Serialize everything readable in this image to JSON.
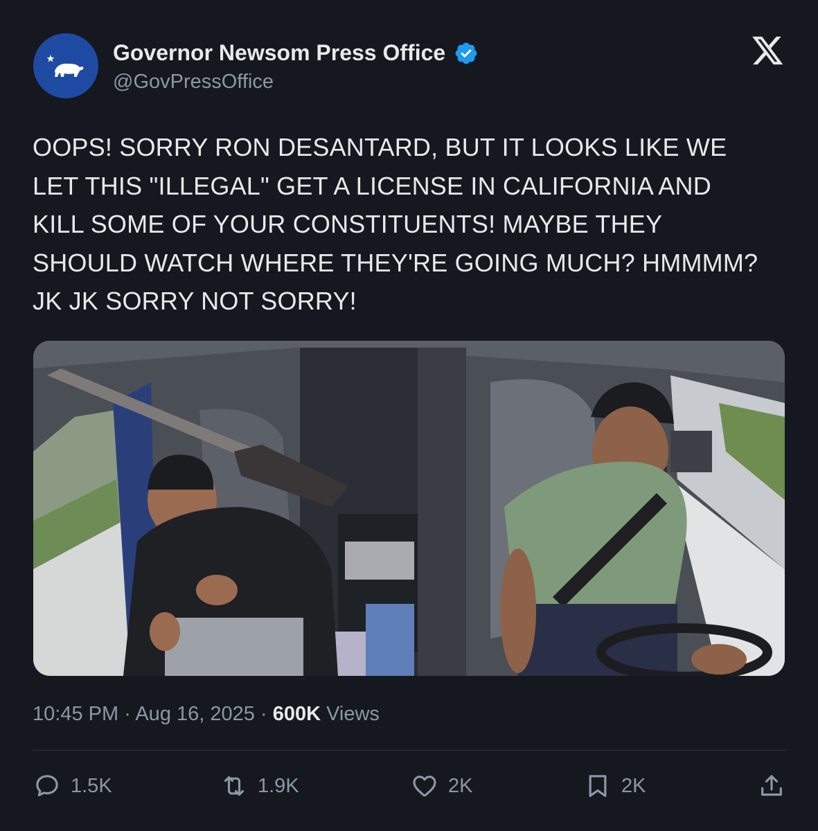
{
  "account": {
    "name": "Governor Newsom Press Office",
    "handle": "@GovPressOffice"
  },
  "tweet": {
    "lines": [
      "OOPS! SORRY RON DESANTARD, BUT IT LOOKS LIKE WE",
      "LET THIS \"ILLEGAL\" GET A LICENSE IN CALIFORNIA AND",
      "KILL SOME OF YOUR CONSTITUENTS! MAYBE THEY",
      "SHOULD WATCH WHERE THEY'RE GOING MUCH? HMMMM?",
      "JK JK SORRY NOT SORRY!"
    ]
  },
  "meta": {
    "time": "10:45 PM",
    "date": "Aug 16, 2025",
    "views_count": "600K",
    "views_label": "Views",
    "separator": "·"
  },
  "actions": {
    "replies": "1.5K",
    "reposts": "1.9K",
    "likes": "2K",
    "bookmarks": "2K"
  },
  "icons": [
    "verified-badge-icon",
    "x-logo-icon",
    "reply-icon",
    "repost-icon",
    "like-icon",
    "bookmark-icon",
    "share-icon"
  ],
  "colors": {
    "background": "#15181e",
    "verified": "#1d9bf0",
    "avatar": "#1f4aa3"
  }
}
